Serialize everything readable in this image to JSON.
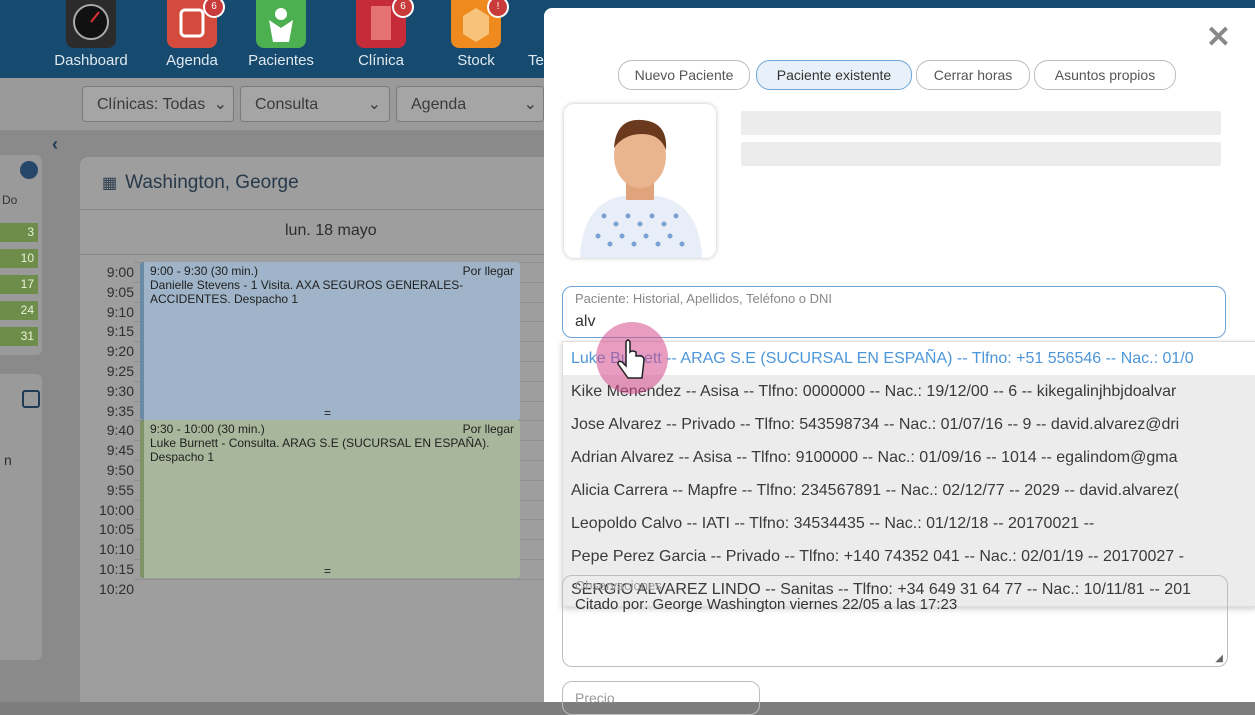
{
  "nav": {
    "apps": [
      {
        "label": "Dashboard",
        "badge": ""
      },
      {
        "label": "Agenda",
        "badge": "6"
      },
      {
        "label": "Pacientes",
        "badge": ""
      },
      {
        "label": "Clínica",
        "badge": "6"
      },
      {
        "label": "Stock",
        "badge": "!"
      },
      {
        "label": "Te",
        "badge": ""
      }
    ]
  },
  "filters": {
    "clinicas": "Clínicas: Todas",
    "consulta": "Consulta",
    "agenda": "Agenda"
  },
  "left_panel": {
    "header": "Do",
    "days": [
      "3",
      "10",
      "17",
      "24",
      "31"
    ],
    "fragment": "n"
  },
  "agenda": {
    "doctor": "Washington, George",
    "day": "lun. 18 mayo",
    "times": [
      "9:00",
      "9:05",
      "9:10",
      "9:15",
      "9:20",
      "9:25",
      "9:30",
      "9:35",
      "9:40",
      "9:45",
      "9:50",
      "9:55",
      "10:00",
      "10:05",
      "10:10",
      "10:15",
      "10:20"
    ],
    "appointments": [
      {
        "time": "9:00 - 9:30 (30 min.)",
        "status": "Por llegar",
        "text": "Danielle Stevens - 1 Visita. AXA SEGUROS GENERALES-ACCIDENTES. Despacho 1",
        "marker": "="
      },
      {
        "time": "9:30 - 10:00 (30 min.)",
        "status": "Por llegar",
        "text": "Luke Burnett - Consulta. ARAG S.E (SUCURSAL EN ESPAÑA). Despacho 1",
        "marker": "="
      }
    ]
  },
  "modal": {
    "close": "✕",
    "tabs": [
      "Nuevo Paciente",
      "Paciente existente",
      "Cerrar horas",
      "Asuntos propios"
    ],
    "active_tab": "Paciente existente",
    "search": {
      "label": "Paciente: Historial, Apellidos, Teléfono o DNI",
      "value": "alv"
    },
    "results": [
      "Luke Burnett -- ARAG S.E (SUCURSAL EN ESPAÑA) -- Tlfno: +51 556546 -- Nac.: 01/0",
      "Kike Menendez -- Asisa -- Tlfno: 0000000 -- Nac.: 19/12/00 -- 6 -- kikegalinjhbjdoalvar",
      "Jose Alvarez -- Privado -- Tlfno: 543598734 -- Nac.: 01/07/16 -- 9 -- david.alvarez@dri",
      "Adrian Alvarez -- Asisa -- Tlfno: 9100000 -- Nac.: 01/09/16 -- 1014 -- egalindom@gma",
      "Alicia Carrera -- Mapfre -- Tlfno: 234567891 -- Nac.: 02/12/77 -- 2029 -- david.alvarez(",
      "Leopoldo Calvo -- IATI -- Tlfno: 34534435 -- Nac.: 01/12/18 -- 20170021 --",
      "Pepe Perez Garcia -- Privado -- Tlfno: +140 74352 041 -- Nac.: 02/01/19 -- 20170027 -",
      "SERGIO ALVAREZ LINDO -- Sanitas -- Tlfno: +34 649 31 64 77 -- Nac.: 10/11/81 -- 201"
    ],
    "observaciones": {
      "label": "Observaciones",
      "text": "Citado por: George Washington viernes 22/05 a las 17:23"
    },
    "precio": {
      "label": "Precio"
    }
  },
  "colors": {
    "accent": "#4d96d8",
    "highlight_border": "#6ea5d6",
    "cursor": "#d64a8c"
  }
}
